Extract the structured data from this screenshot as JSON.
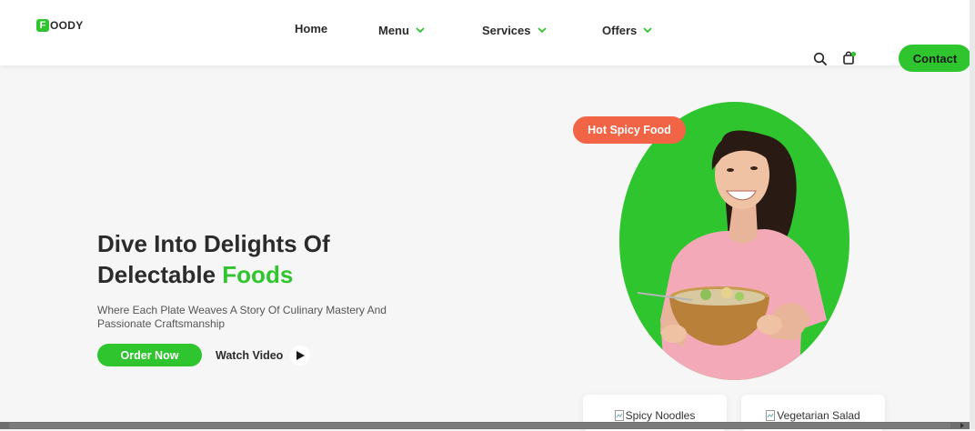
{
  "logo": {
    "mark": "F",
    "text": "OODY"
  },
  "nav": {
    "home": "Home",
    "menu": "Menu",
    "services": "Services",
    "offers": "Offers"
  },
  "header": {
    "contact_label": "Contact"
  },
  "hero": {
    "title_line1": "Dive Into Delights Of",
    "title_line2_prefix": "Delectable ",
    "title_line2_accent": "Foods",
    "subtitle": "Where Each Plate Weaves A Story Of Culinary Mastery And Passionate Craftsmanship",
    "order_label": "Order Now",
    "watch_label": "Watch Video",
    "badge": "Hot Spicy Food"
  },
  "cards": [
    {
      "alt": "Spicy Noodles"
    },
    {
      "alt": "Vegetarian Salad"
    }
  ],
  "colors": {
    "accent": "#2ec52e",
    "badge": "#f26446",
    "text": "#2b2b2b"
  }
}
